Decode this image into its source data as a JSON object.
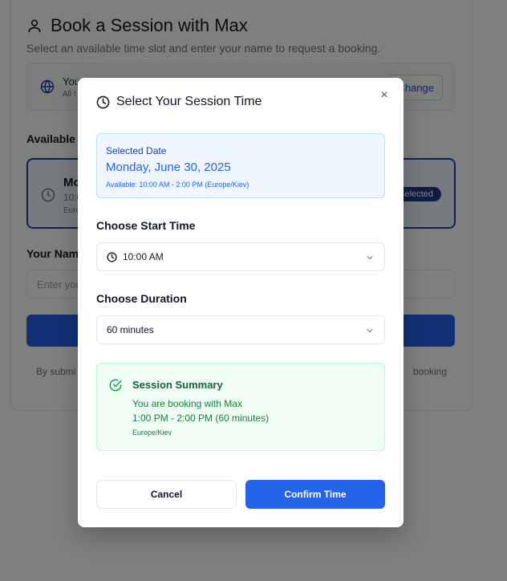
{
  "background": {
    "title": "Book a Session with Max",
    "subtitle": "Select an available time slot and enter your name to request a booking.",
    "timezone_label": "You",
    "timezone_sub": "All t",
    "change_button": "Change",
    "available_label": "Available",
    "slot_day": "Mo",
    "slot_time": "10:0",
    "slot_tz": "Euro",
    "slot_badge": "Selected",
    "name_label": "Your Nam",
    "name_placeholder": "Enter you",
    "disclaimer_left": "By submi",
    "disclaimer_right": "booking"
  },
  "modal": {
    "title": "Select Your Session Time",
    "close_icon": "×",
    "selected_date_label": "Selected Date",
    "selected_date_value": "Monday, June 30, 2025",
    "availability": "Available: 10:00 AM - 2:00 PM (Europe/Kiev)",
    "start_time_label": "Choose Start Time",
    "start_time_value": "10:00 AM",
    "duration_label": "Choose Duration",
    "duration_value": "60 minutes",
    "summary_title": "Session Summary",
    "summary_line1": "You are booking with Max",
    "summary_line2": "1:00 PM - 2:00 PM (60 minutes)",
    "summary_line3": "Europe/Kiev",
    "cancel_label": "Cancel",
    "confirm_label": "Confirm Time"
  },
  "colors": {
    "accent": "#2563eb",
    "summary_green": "#166534",
    "date_blue": "#1e40af"
  },
  "icons": [
    "user-icon",
    "globe-icon",
    "clock-icon",
    "close-icon",
    "chevron-down-icon",
    "check-circle-icon"
  ]
}
